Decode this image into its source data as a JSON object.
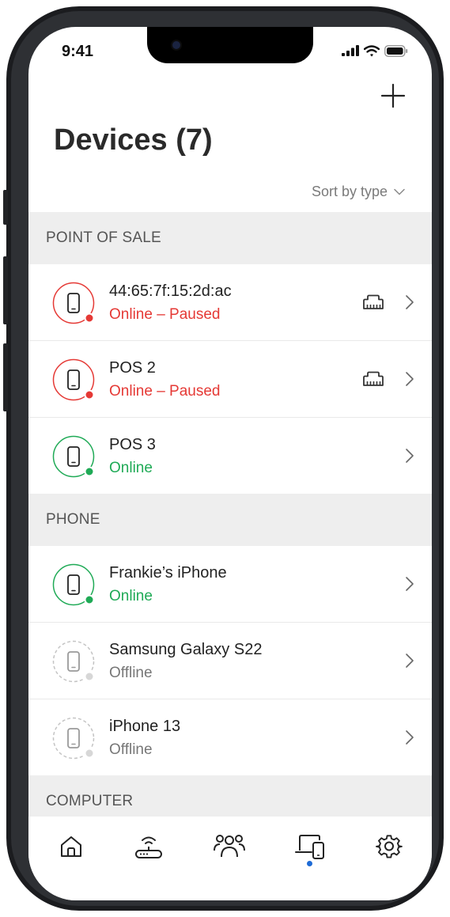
{
  "status_bar": {
    "time": "9:41"
  },
  "header": {
    "title": "Devices (7)"
  },
  "sort": {
    "label": "Sort by type"
  },
  "sections": [
    {
      "title": "POINT OF SALE",
      "devices": [
        {
          "name": "44:65:7f:15:2d:ac",
          "status": "Online – Paused",
          "state": "paused",
          "ethernet": true
        },
        {
          "name": "POS 2",
          "status": "Online – Paused",
          "state": "paused",
          "ethernet": true
        },
        {
          "name": "POS 3",
          "status": "Online",
          "state": "online",
          "ethernet": false
        }
      ]
    },
    {
      "title": "PHONE",
      "devices": [
        {
          "name": "Frankie’s iPhone",
          "status": "Online",
          "state": "online",
          "ethernet": false
        },
        {
          "name": "Samsung Galaxy S22",
          "status": "Offline",
          "state": "offline",
          "ethernet": false
        },
        {
          "name": "iPhone 13",
          "status": "Offline",
          "state": "offline",
          "ethernet": false
        }
      ]
    },
    {
      "title": "COMPUTER",
      "devices": []
    }
  ],
  "tabbar": {
    "tabs": [
      {
        "icon": "home-icon"
      },
      {
        "icon": "router-icon"
      },
      {
        "icon": "people-icon"
      },
      {
        "icon": "devices-icon",
        "active": true
      },
      {
        "icon": "gear-icon"
      }
    ]
  },
  "colors": {
    "paused": "#e53935",
    "online": "#1faa56",
    "offline": "#bdbdbd",
    "accent": "#1e6bd6"
  }
}
